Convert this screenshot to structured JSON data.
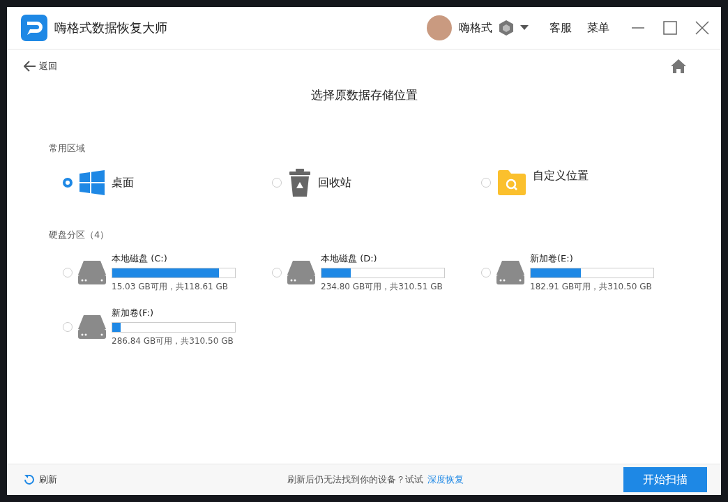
{
  "window": {
    "title": "嗨格式数据恢复大师",
    "user": "嗨格式",
    "links": [
      "客服",
      "菜单"
    ]
  },
  "back": "返回",
  "heading": "选择原数据存储位置",
  "common": {
    "label": "常用区域",
    "items": [
      {
        "kind": "desktop",
        "label": "桌面",
        "selected": true
      },
      {
        "kind": "recycle",
        "label": "回收站",
        "selected": false
      },
      {
        "kind": "custom",
        "label": "自定义位置",
        "selected": false
      }
    ]
  },
  "disks": {
    "label": "硬盘分区（4）",
    "items": [
      {
        "name": "本地磁盘 (C:)",
        "level": 0.87,
        "info": "15.03 GB可用，共118.61 GB",
        "selected": false
      },
      {
        "name": "本地磁盘 (D:)",
        "level": 0.24,
        "info": "234.80 GB可用，共310.51 GB",
        "selected": false
      },
      {
        "name": "新加卷(E:)",
        "level": 0.41,
        "info": "182.91 GB可用，共310.50 GB",
        "selected": false
      },
      {
        "name": "新加卷(F:)",
        "level": 0.07,
        "info": "286.84 GB可用，共310.50 GB",
        "selected": false
      }
    ]
  },
  "footer": {
    "refresh": "刷新",
    "hint": "刷新后仍无法找到你的设备？试试",
    "link": "深度恢复",
    "button": "开始扫描"
  }
}
